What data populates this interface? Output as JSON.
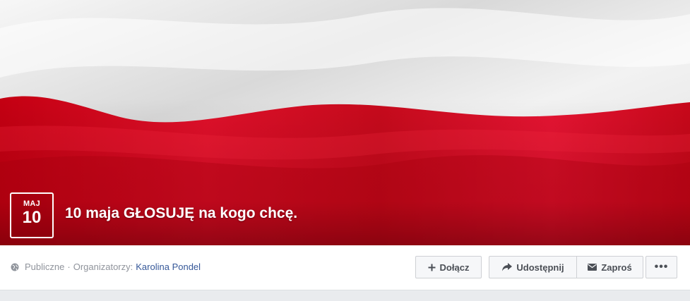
{
  "event": {
    "date_month": "MAJ",
    "date_day": "10",
    "title": "10 maja GŁOSUJĘ na kogo chcę."
  },
  "info": {
    "privacy": "Publiczne",
    "separator": "·",
    "organizers_label": "Organizatorzy:",
    "organizer_name": "Karolina Pondel"
  },
  "actions": {
    "join_label": "Dołącz",
    "share_label": "Udostępnij",
    "invite_label": "Zaproś",
    "more_label": "•••"
  },
  "colors": {
    "flag_white": "#f0f0f0",
    "flag_red": "#d00a1c",
    "link": "#365899"
  }
}
